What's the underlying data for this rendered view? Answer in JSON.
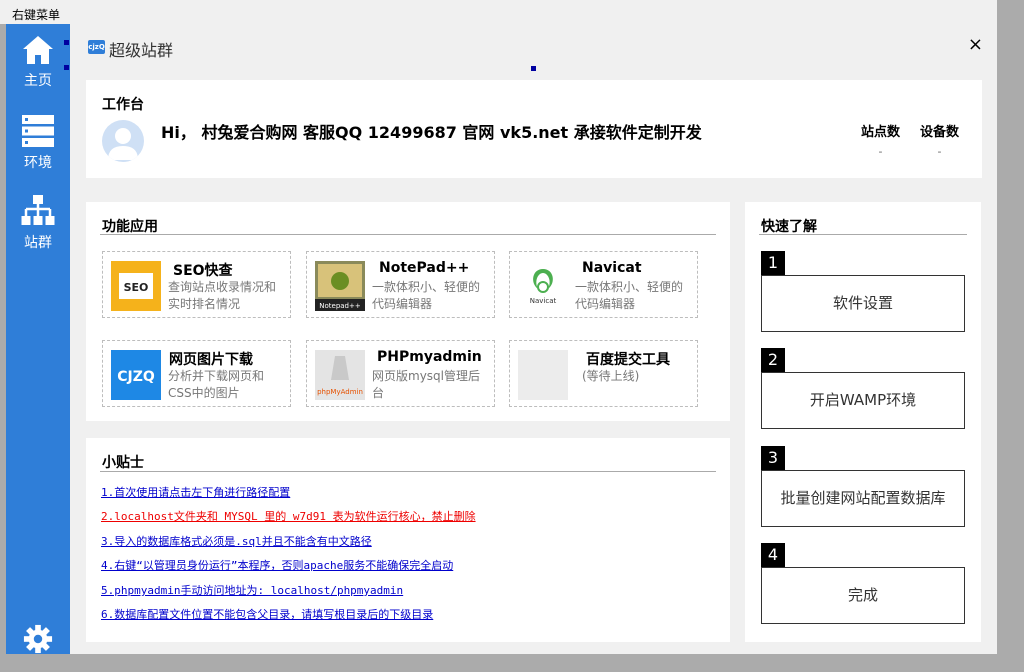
{
  "outer_window": {
    "title": "右键菜单"
  },
  "sidebar": {
    "items": [
      {
        "label": "主页",
        "icon": "home-icon"
      },
      {
        "label": "环境",
        "icon": "server-icon"
      },
      {
        "label": "站群",
        "icon": "sitemap-icon"
      }
    ],
    "settings_icon": "gear-icon",
    "color": "#2f7ed8"
  },
  "window": {
    "logo_text": "cjzQ",
    "title": "超级站群",
    "close": "×"
  },
  "workbench": {
    "title": "工作台",
    "greeting": "Hi， 村兔爱合购网  客服QQ 12499687 官网 vk5.net 承接软件定制开发",
    "stats": [
      {
        "label": "站点数",
        "value": "-"
      },
      {
        "label": "设备数",
        "value": "-"
      }
    ]
  },
  "apps": {
    "title": "功能应用",
    "items": [
      {
        "name": "SEO快查",
        "desc": "查询站点收录情况和实时排名情况",
        "icon": "seo-icon"
      },
      {
        "name": "NotePad++",
        "desc": "一款体积小、轻便的代码编辑器",
        "icon": "notepad-icon"
      },
      {
        "name": "Navicat",
        "desc": "一款体积小、轻便的代码编辑器",
        "icon": "navicat-icon"
      },
      {
        "name": "网页图片下载",
        "desc": "分析并下载网页和CSS中的图片",
        "icon": "cjzq-icon"
      },
      {
        "name": "PHPmyadmin",
        "desc": "网页版mysql管理后台",
        "icon": "phpmyadmin-icon"
      },
      {
        "name": "百度提交工具",
        "desc": "(等待上线)",
        "icon": "blank-icon"
      }
    ]
  },
  "tips": {
    "title": "小贴士",
    "items": [
      {
        "text": "1.首次使用请点击左下角进行路径配置",
        "color": "#0000cc"
      },
      {
        "text": "2.localhost文件夹和 MYSQL 里的 w7d91 表为软件运行核心，禁止删除",
        "color": "#ee0000"
      },
      {
        "text": "3.导入的数据库格式必须是.sql并且不能含有中文路径",
        "color": "#0000cc"
      },
      {
        "text": "4.右键“以管理员身份运行”本程序，否则apache服务不能确保完全启动",
        "color": "#0000cc"
      },
      {
        "text": "5.phpmyadmin手动访问地址为: localhost/phpmyadmin",
        "color": "#0000cc"
      },
      {
        "text": "6.数据库配置文件位置不能包含父目录，请填写根目录后的下级目录",
        "color": "#0000cc"
      }
    ]
  },
  "quickstart": {
    "title": "快速了解",
    "steps": [
      {
        "num": "1",
        "label": "软件设置"
      },
      {
        "num": "2",
        "label": "开启WAMP环境"
      },
      {
        "num": "3",
        "label": "批量创建网站配置数据库"
      },
      {
        "num": "4",
        "label": "完成"
      }
    ]
  }
}
